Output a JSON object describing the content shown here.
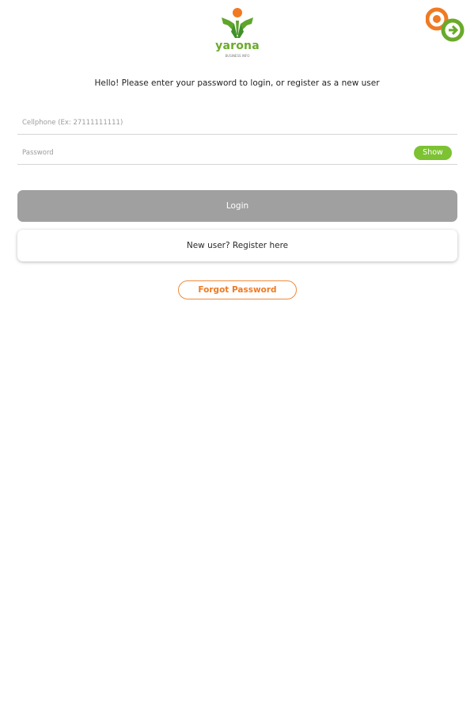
{
  "logo": {
    "text": "yarona",
    "subtext": "BUSINESS INFO",
    "icon": "yarona-person-logo-icon"
  },
  "corner_badge": {
    "icon": "ctc-connect-badge-icon"
  },
  "greeting": "Hello! Please enter your password to login, or register as a new user",
  "form": {
    "phone": {
      "placeholder": "Cellphone (Ex: 27111111111)",
      "value": ""
    },
    "password": {
      "placeholder": "Password",
      "value": "",
      "show_label": "Show"
    }
  },
  "buttons": {
    "login": "Login",
    "register": "New user? Register here",
    "forgot": "Forgot Password"
  },
  "colors": {
    "brand_green": "#7cc232",
    "brand_orange": "#ef7a23",
    "login_disabled": "#a0a0a0"
  }
}
